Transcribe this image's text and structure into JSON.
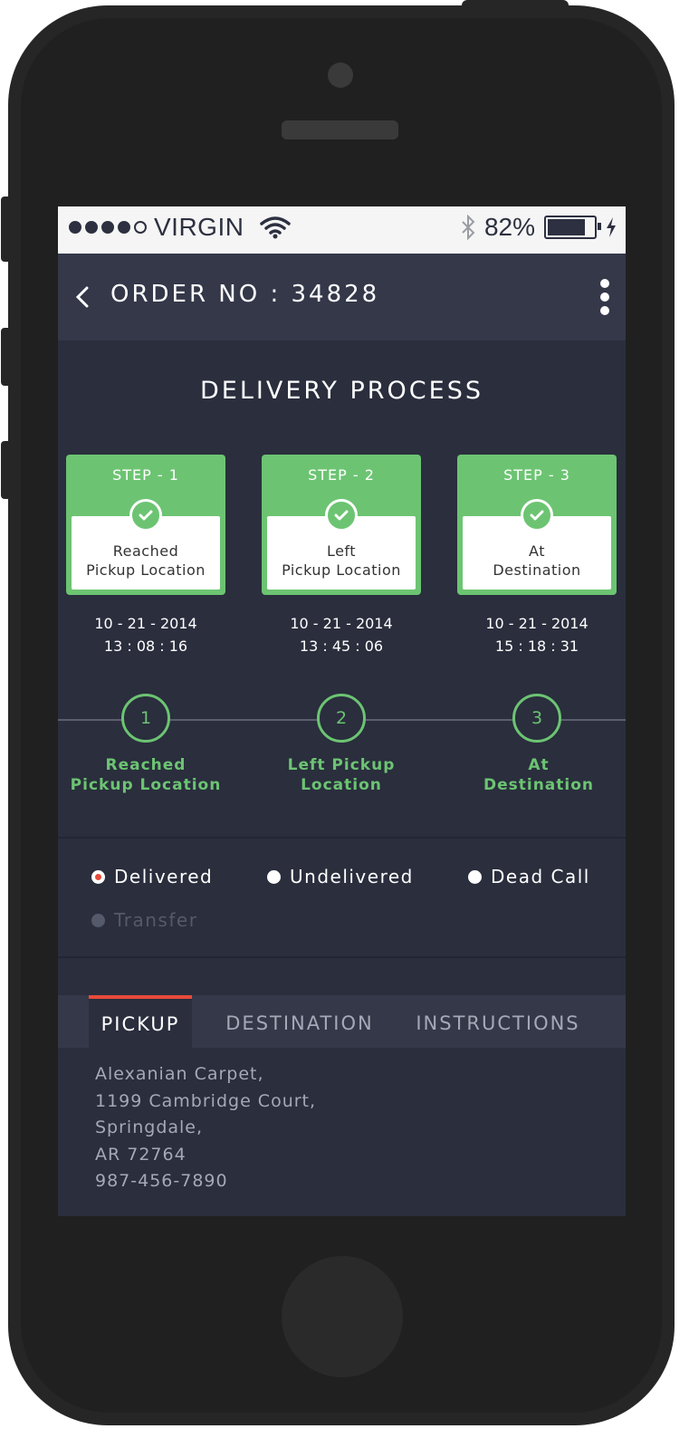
{
  "status_bar": {
    "carrier": "VIRGIN",
    "battery_percent": "82%",
    "signal_bars_filled": 4,
    "signal_bars_total": 5
  },
  "header": {
    "title": "ORDER NO : 34828"
  },
  "section": {
    "title": "DELIVERY PROCESS"
  },
  "steps": [
    {
      "label": "STEP - 1",
      "line1": "Reached",
      "line2": "Pickup Location",
      "date": "10 - 21 - 2014",
      "time": "13 : 08 : 16"
    },
    {
      "label": "STEP - 2",
      "line1": "Left",
      "line2": "Pickup Location",
      "date": "10 - 21 - 2014",
      "time": "13 : 45 : 06"
    },
    {
      "label": "STEP - 3",
      "line1": "At",
      "line2": "Destination",
      "date": "10 - 21 - 2014",
      "time": "15 : 18 : 31"
    }
  ],
  "timeline": [
    {
      "number": "1",
      "line1": "Reached",
      "line2": "Pickup Location"
    },
    {
      "number": "2",
      "line1": "Left Pickup",
      "line2": "Location"
    },
    {
      "number": "3",
      "line1": "At",
      "line2": "Destination"
    }
  ],
  "delivery_status": {
    "selected": "Delivered",
    "options": [
      {
        "label": "Delivered",
        "selected": true,
        "disabled": false
      },
      {
        "label": "Undelivered",
        "selected": false,
        "disabled": false
      },
      {
        "label": "Dead Call",
        "selected": false,
        "disabled": false
      },
      {
        "label": "Transfer",
        "selected": false,
        "disabled": true
      }
    ]
  },
  "tabs": [
    {
      "label": "PICKUP",
      "active": true
    },
    {
      "label": "DESTINATION",
      "active": false
    },
    {
      "label": "INSTRUCTIONS",
      "active": false
    }
  ],
  "address": {
    "lines": [
      "Alexanian Carpet,",
      "1199 Cambridge Court,",
      "Springdale,",
      "AR 72764",
      "987-456-7890"
    ]
  },
  "colors": {
    "accent_green": "#6cc472",
    "accent_red": "#e84a3a",
    "background": "#2a2e3d",
    "appbar": "#343849"
  },
  "icons": {
    "back": "chevron-left-icon",
    "menu": "more-vertical-icon",
    "check": "check-icon",
    "wifi": "wifi-icon",
    "bluetooth": "bluetooth-icon",
    "charging": "charging-bolt-icon"
  }
}
